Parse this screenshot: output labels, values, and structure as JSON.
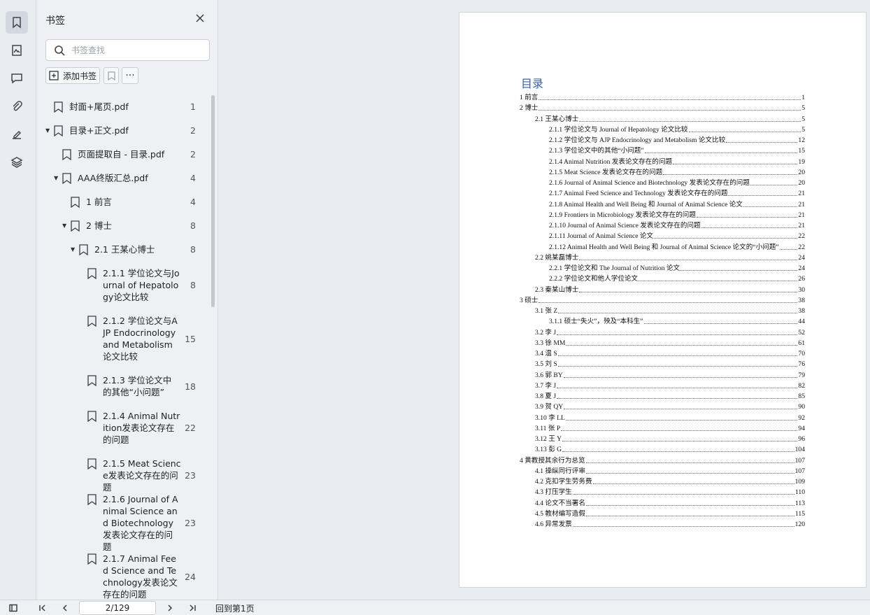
{
  "panel": {
    "title": "书签",
    "search_placeholder": "书签查找",
    "add_bookmark_label": "添加书签",
    "more_label": "···"
  },
  "bookmarks": [
    {
      "label": "封面+尾页.pdf",
      "page": "1"
    },
    {
      "label": "目录+正文.pdf",
      "page": "2"
    },
    {
      "label": "页面提取自 - 目录.pdf",
      "page": "2"
    },
    {
      "label": "AAA终版汇总.pdf",
      "page": "4"
    },
    {
      "label": "1 前言",
      "page": "4"
    },
    {
      "label": "2 博士",
      "page": "8"
    },
    {
      "label": "2.1 王某心博士",
      "page": "8"
    },
    {
      "label": "2.1.1 学位论文与Journal of Hepatology论文比较",
      "page": "8"
    },
    {
      "label": "2.1.2 学位论文与AJP Endocrinology and Metabolism论文比较",
      "page": "15"
    },
    {
      "label": "2.1.3 学位论文中的其他“小问题”",
      "page": "18"
    },
    {
      "label": "2.1.4 Animal Nutrition发表论文存在的问题",
      "page": "22"
    },
    {
      "label": "2.1.5 Meat Science发表论文存在的问题",
      "page": "23"
    },
    {
      "label": "2.1.6 Journal of Animal Science and Biotechnology发表论文存在的问题",
      "page": "23"
    },
    {
      "label": "2.1.7 Animal Feed Science and Technology发表论文存在的问题",
      "page": "24"
    }
  ],
  "toc": {
    "title": "目录",
    "entries": [
      {
        "text": "1  前言",
        "page": "1"
      },
      {
        "text": "2  博士",
        "page": "5"
      },
      {
        "text": "2.1  王某心博士",
        "page": "5"
      },
      {
        "text": "2.1.1  学位论文与 Journal of Hepatology 论文比较",
        "page": "5"
      },
      {
        "text": "2.1.2  学位论文与 AJP Endocrinology and Metabolism 论文比较",
        "page": "12"
      },
      {
        "text": "2.1.3  学位论文中的其他“小问题”",
        "page": "15"
      },
      {
        "text": "2.1.4 Animal Nutrition 发表论文存在的问题",
        "page": "19"
      },
      {
        "text": "2.1.5 Meat Science 发表论文存在的问题",
        "page": "20"
      },
      {
        "text": "2.1.6 Journal of Animal Science and Biotechnology 发表论文存在的问题",
        "page": "20"
      },
      {
        "text": "2.1.7 Animal Feed Science and Technology 发表论文存在的问题",
        "page": "21"
      },
      {
        "text": "2.1.8 Animal Health and Well Being  和  Journal of Animal Science 论文",
        "page": "21"
      },
      {
        "text": "2.1.9 Frontiers in Microbiology 发表论文存在的问题",
        "page": "21"
      },
      {
        "text": "2.1.10 Journal of Animal Science 发表论文存在的问题",
        "page": "21"
      },
      {
        "text": "2.1.11 Journal of Animal Science 论文",
        "page": "22"
      },
      {
        "text": "2.1.12 Animal Health and Well Being 和 Journal of Animal Science 论文的“小问题”",
        "page": "22"
      },
      {
        "text": "2.2  姚某磊博士",
        "page": "24"
      },
      {
        "text": "2.2.1 学位论文和 The Journal of Nutrition 论文",
        "page": "24"
      },
      {
        "text": "2.2.2 学位论文和他人学位论文",
        "page": "26"
      },
      {
        "text": "2.3  秦某山博士",
        "page": "30"
      },
      {
        "text": "3  硕士",
        "page": "38"
      },
      {
        "text": "3.1  张 Z",
        "page": "38"
      },
      {
        "text": "3.1.1  硕士“失火”，殃及“本科生”",
        "page": "44"
      },
      {
        "text": "3.2  李 J",
        "page": "52"
      },
      {
        "text": "3.3  徐 MM",
        "page": "61"
      },
      {
        "text": "3.4  温 S",
        "page": "70"
      },
      {
        "text": "3.5  刘 S",
        "page": "76"
      },
      {
        "text": "3.6  郭 BY",
        "page": "79"
      },
      {
        "text": "3.7  李 J",
        "page": "82"
      },
      {
        "text": "3.8  夏 J",
        "page": "85"
      },
      {
        "text": "3.9  贺 QY",
        "page": "90"
      },
      {
        "text": "3.10  李 LL",
        "page": "92"
      },
      {
        "text": "3.11  张 P",
        "page": "94"
      },
      {
        "text": "3.12  王 Y",
        "page": "96"
      },
      {
        "text": "3.13  彭 G",
        "page": "104"
      },
      {
        "text": "4  黄教授其余行为总览",
        "page": "107"
      },
      {
        "text": "4.1  操纵同行评审",
        "page": "107"
      },
      {
        "text": "4.2  克扣学生劳务费",
        "page": "109"
      },
      {
        "text": "4.3  打压学生",
        "page": "110"
      },
      {
        "text": "4.4  论文不当署名",
        "page": "113"
      },
      {
        "text": "4.5  教材编写造假",
        "page": "115"
      },
      {
        "text": "4.6  异常发票",
        "page": "120"
      }
    ]
  },
  "status": {
    "page_indicator": "2/129",
    "back_to_first": "回到第1页"
  },
  "colors": {
    "accent": "#3b5fa0",
    "panel_bg": "#eef0f4"
  }
}
